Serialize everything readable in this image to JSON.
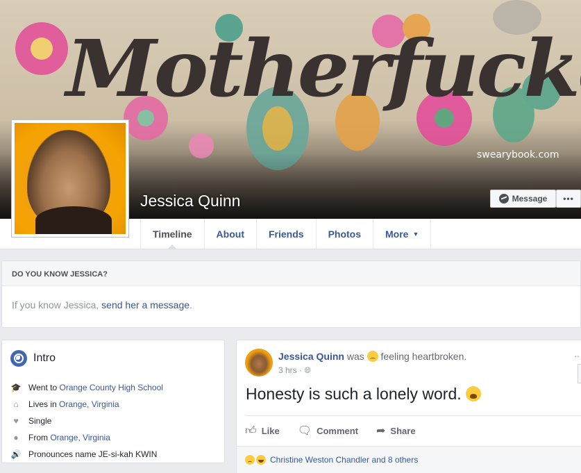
{
  "cover": {
    "art_text": "Motherfucker",
    "site_text": "swearybook.com"
  },
  "profile": {
    "name": "Jessica Quinn",
    "message_button": "Message",
    "more_button": "•••"
  },
  "tabs": [
    {
      "label": "Timeline",
      "active": true
    },
    {
      "label": "About"
    },
    {
      "label": "Friends"
    },
    {
      "label": "Photos"
    },
    {
      "label": "More"
    }
  ],
  "know_box": {
    "heading": "DO YOU KNOW JESSICA?",
    "prefix": "If you know Jessica,",
    "link": "send her a message",
    "suffix": "."
  },
  "intro": {
    "title": "Intro",
    "items": [
      {
        "icon": "graduation-cap-icon",
        "text": "Went to",
        "link": "Orange County High School"
      },
      {
        "icon": "home-icon",
        "text": "Lives in",
        "link": "Orange, Virginia"
      },
      {
        "icon": "heart-icon",
        "text": "Single",
        "link": ""
      },
      {
        "icon": "location-pin-icon",
        "text": "From",
        "link": "Orange, Virginia"
      },
      {
        "icon": "sound-icon",
        "text": "Pronounces name JE-si-kah KWIN",
        "link": ""
      }
    ]
  },
  "post": {
    "author": "Jessica Quinn",
    "was": "was",
    "feeling": "feeling heartbroken.",
    "time": "3 hrs ·",
    "text": "Honesty is such a lonely word.",
    "actions": {
      "like": "Like",
      "comment": "Comment",
      "share": "Share"
    },
    "reactions_text": "Christine Weston Chandler and 8 others"
  }
}
